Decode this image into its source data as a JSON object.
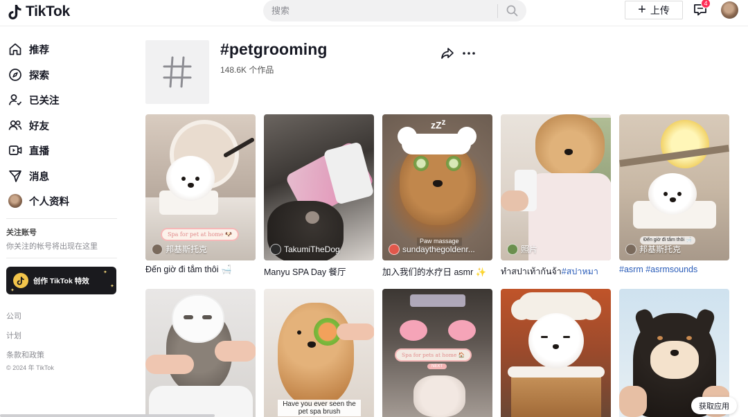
{
  "header": {
    "logo_text": "TikTok",
    "search_placeholder": "搜索",
    "upload_label": "上传",
    "inbox_badge": "4"
  },
  "sidebar": {
    "nav": [
      {
        "label": "推荐",
        "icon": "home-icon"
      },
      {
        "label": "探索",
        "icon": "compass-icon"
      },
      {
        "label": "已关注",
        "icon": "following-icon"
      },
      {
        "label": "好友",
        "icon": "friends-icon"
      },
      {
        "label": "直播",
        "icon": "live-icon"
      },
      {
        "label": "消息",
        "icon": "messages-icon"
      },
      {
        "label": "个人资料",
        "icon": "profile-avatar"
      }
    ],
    "following_title": "关注账号",
    "following_desc": "你关注的帐号将出现在这里",
    "effects_label": "创作 TikTok 特效",
    "footer": [
      "公司",
      "计划",
      "条款和政策"
    ],
    "copyright": "© 2024 年 TikTok"
  },
  "hashtag": {
    "title": "#petgrooming",
    "count": "148.6K 个作品"
  },
  "videos": [
    {
      "author": "邦基斯托克",
      "caption": "Đến giờ đi tắm thôi 🛁",
      "overlay": "Spa for pet at home 🐶"
    },
    {
      "author": "TakumiTheDog",
      "caption": "Manyu SPA Day 餐厅"
    },
    {
      "author": "sundaythegoldenr...",
      "caption_text": "加入我们的水疗日 asmr ✨",
      "overlay": "Paw massage"
    },
    {
      "author": "照片",
      "caption_text": "ทําสปาเท้ากันจ้า",
      "caption_tag": "#สปาหมา"
    },
    {
      "author": "邦基斯托克",
      "caption_tag": "#asrm #asrmsounds",
      "overlay": "Đến giờ đi tắm thôi 🛁"
    },
    {
      "author": ""
    },
    {
      "overlay": "Have you ever seen the pet spa brush"
    },
    {
      "overlay": "Spa for pets at home 🏠",
      "overlay2": "NEXT"
    },
    {
      "author": ""
    },
    {
      "author": ""
    }
  ],
  "get_app_label": "获取应用",
  "colors": {
    "accent": "#fe2c55",
    "hashtag_link": "#2b5db9",
    "sidebar_button_bg": "#1a1a1e"
  }
}
